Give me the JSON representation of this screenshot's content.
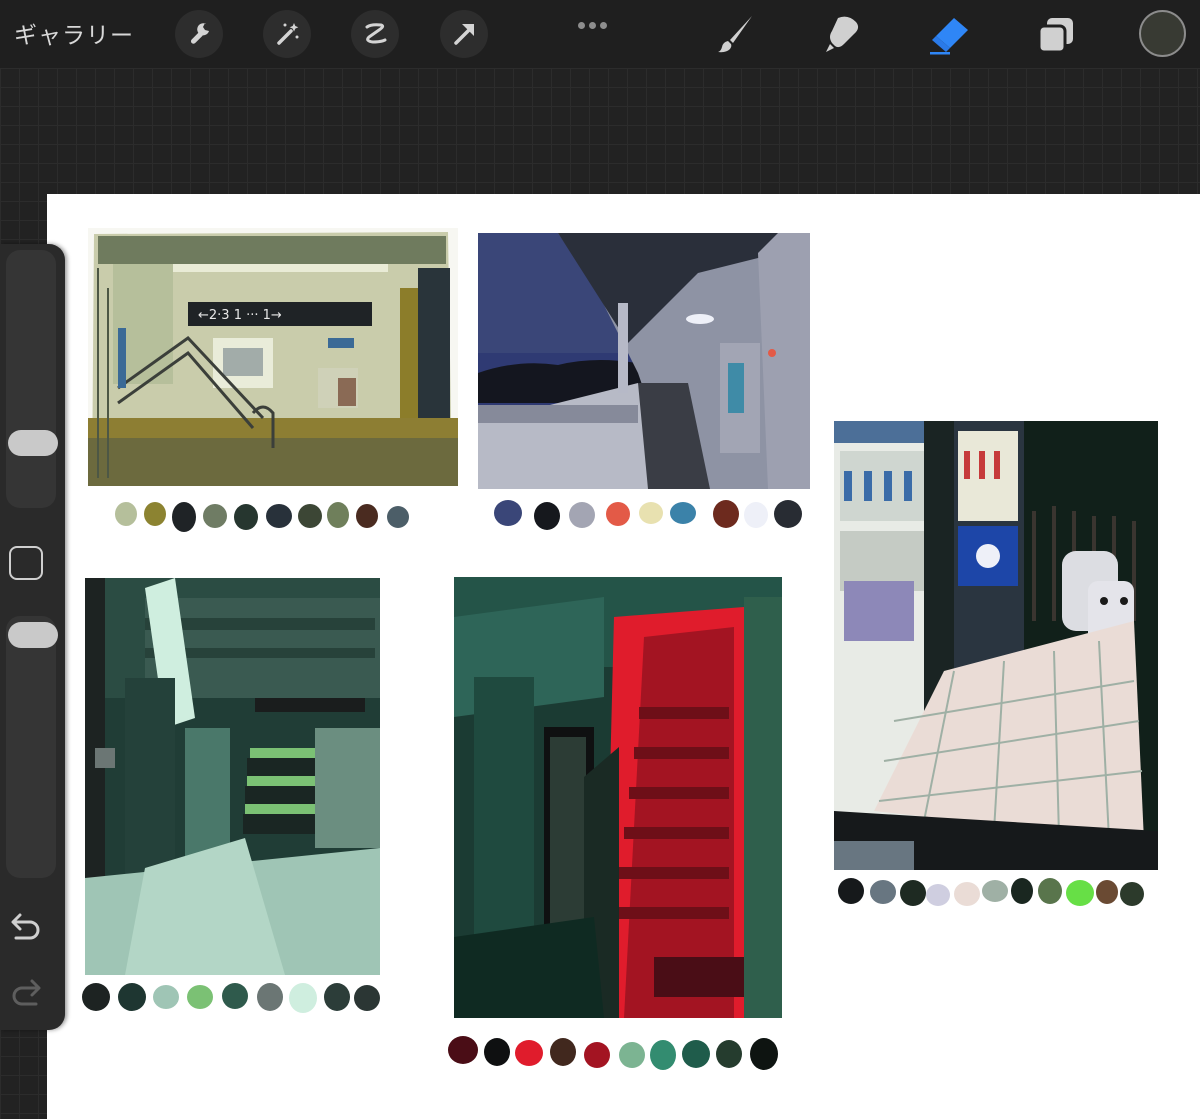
{
  "toolbar": {
    "gallery_label": "ギャラリー",
    "tools_left": [
      "wrench-icon",
      "magic-wand-icon",
      "selection-icon",
      "transform-arrow-icon"
    ],
    "tools_right": [
      "brush-icon",
      "smudge-icon",
      "eraser-icon",
      "layers-icon"
    ],
    "active_tool": "eraser-icon",
    "accent_color": "#2f86f6",
    "current_color": "#383a33"
  },
  "sidebar": {
    "brush_size_icon": "slider",
    "modifier_icon": "square-icon",
    "undo_icon": "undo-icon",
    "redo_icon": "redo-icon"
  },
  "artworks": [
    {
      "name": "station-stairs",
      "palette": [
        "#b5bf9b",
        "#8c8331",
        "#1f2326",
        "#6f7c64",
        "#26362f",
        "#28313a",
        "#3c4635",
        "#6f7f5b",
        "#4a2b20",
        "#4c5e68"
      ]
    },
    {
      "name": "night-walkway",
      "palette": [
        "#3a4678",
        "#16181d",
        "#a3a5b3",
        "#e35a47",
        "#e8e1b0",
        "#3b82a9",
        "#6d2a1e",
        "#eef0f8",
        "#282c33"
      ]
    },
    {
      "name": "underground-corridor",
      "palette": [
        "#1d2322",
        "#1e3631",
        "#9fc5b5",
        "#7bc174",
        "#2f5a4c",
        "#6b7674",
        "#cfeedf",
        "#2c3d39",
        "#2b3634"
      ]
    },
    {
      "name": "red-stairwell",
      "palette": [
        "#4a0d16",
        "#0f1011",
        "#e01c2c",
        "#41281e",
        "#a31422",
        "#7cb492",
        "#338c70",
        "#1f5c4b",
        "#253c2e",
        "#0e1411"
      ]
    },
    {
      "name": "vending-machines",
      "palette": [
        "#16191b",
        "#687681",
        "#1e2a22",
        "#cfcee0",
        "#eadcd6",
        "#9fb0a5",
        "#1a2720",
        "#59754c",
        "#67df46",
        "#6a4a33",
        "#2c3a2b"
      ]
    }
  ]
}
